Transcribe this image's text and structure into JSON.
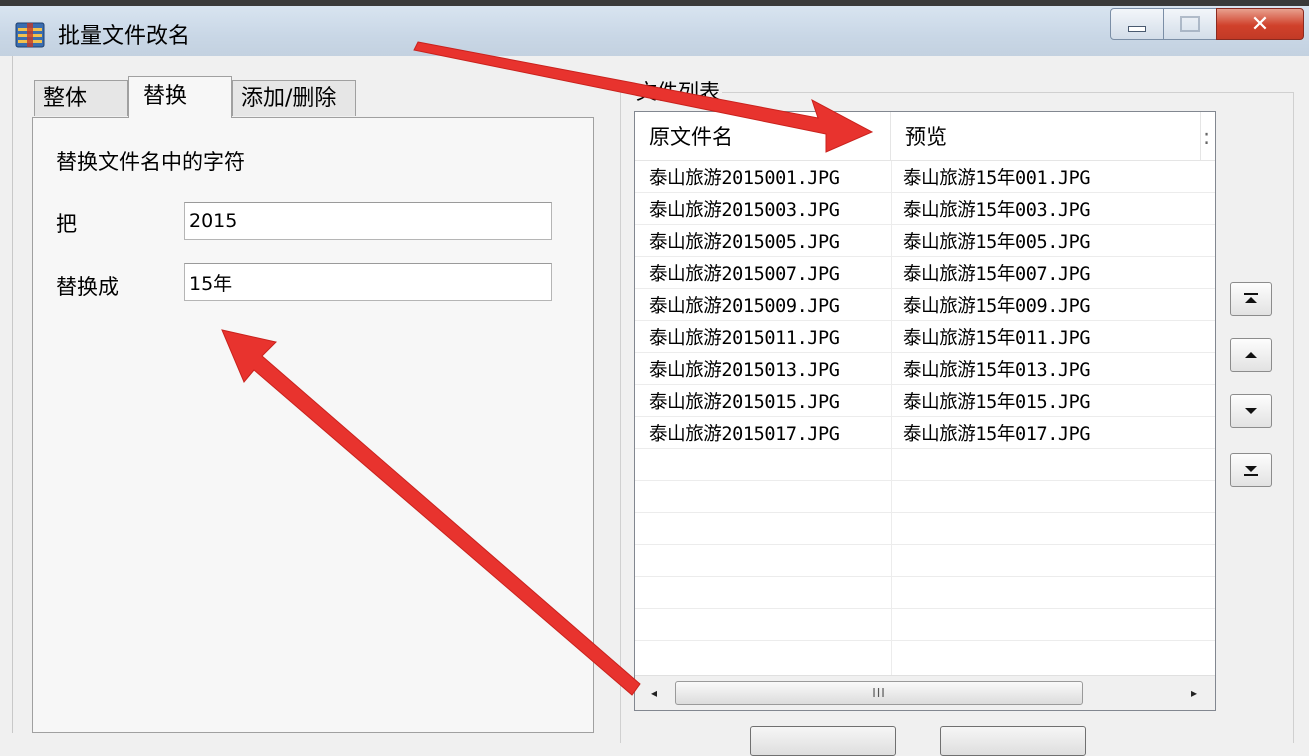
{
  "window": {
    "title": "批量文件改名",
    "close_glyph": "✕"
  },
  "tabs": [
    {
      "label": "整体"
    },
    {
      "label": "替换"
    },
    {
      "label": "添加/删除"
    }
  ],
  "replace_panel": {
    "heading": "替换文件名中的字符",
    "find_label": "把",
    "find_value": "2015",
    "replace_label": "替换成",
    "replace_value": "15年"
  },
  "file_list": {
    "group_label": "文件列表",
    "columns": [
      "原文件名",
      "预览",
      ":"
    ],
    "rows": [
      {
        "original": "泰山旅游2015001.JPG",
        "preview": "泰山旅游15年001.JPG"
      },
      {
        "original": "泰山旅游2015003.JPG",
        "preview": "泰山旅游15年003.JPG"
      },
      {
        "original": "泰山旅游2015005.JPG",
        "preview": "泰山旅游15年005.JPG"
      },
      {
        "original": "泰山旅游2015007.JPG",
        "preview": "泰山旅游15年007.JPG"
      },
      {
        "original": "泰山旅游2015009.JPG",
        "preview": "泰山旅游15年009.JPG"
      },
      {
        "original": "泰山旅游2015011.JPG",
        "preview": "泰山旅游15年011.JPG"
      },
      {
        "original": "泰山旅游2015013.JPG",
        "preview": "泰山旅游15年013.JPG"
      },
      {
        "original": "泰山旅游2015015.JPG",
        "preview": "泰山旅游15年015.JPG"
      },
      {
        "original": "泰山旅游2015017.JPG",
        "preview": "泰山旅游15年017.JPG"
      }
    ],
    "empty_rows": 6,
    "scrollbar": {
      "left_arrow": "◂",
      "right_arrow": "▸",
      "thumb_grip": "III"
    }
  },
  "colors": {
    "annotation_arrow": "#e8332e",
    "selected_tab": "#f7f7f7"
  },
  "icons": [
    "app-icon",
    "minimize-icon",
    "maximize-icon",
    "close-icon",
    "move-top-icon",
    "move-up-icon",
    "move-down-icon",
    "move-bottom-icon"
  ]
}
